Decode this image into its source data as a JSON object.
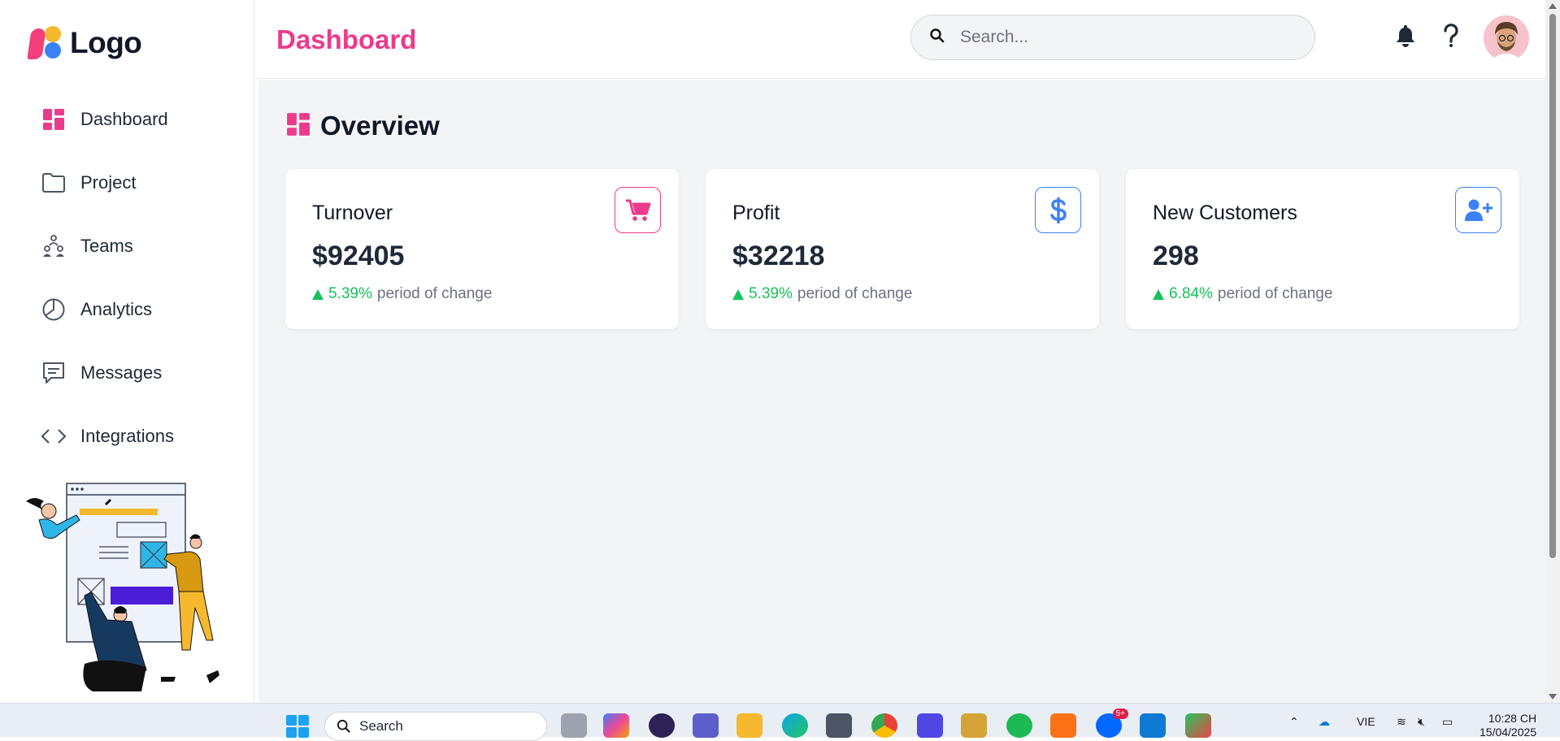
{
  "sidebar": {
    "logo_text": "Logo",
    "items": [
      {
        "label": "Dashboard",
        "icon": "dashboard-grid-icon"
      },
      {
        "label": "Project",
        "icon": "folder-icon"
      },
      {
        "label": "Teams",
        "icon": "teams-icon"
      },
      {
        "label": "Analytics",
        "icon": "pie-chart-icon"
      },
      {
        "label": "Messages",
        "icon": "message-icon"
      },
      {
        "label": "Integrations",
        "icon": "code-brackets-icon"
      }
    ]
  },
  "header": {
    "title": "Dashboard",
    "search_placeholder": "Search..."
  },
  "main": {
    "section_title": "Overview",
    "cards": [
      {
        "title": "Turnover",
        "value": "$92405",
        "change_pct": "5.39%",
        "change_text": "period of change",
        "icon": "cart-icon",
        "color": "#ec3a8c"
      },
      {
        "title": "Profit",
        "value": "$32218",
        "change_pct": "5.39%",
        "change_text": "period of change",
        "icon": "dollar-icon",
        "color": "#3b82f6"
      },
      {
        "title": "New Customers",
        "value": "298",
        "change_pct": "6.84%",
        "change_text": "period of change",
        "icon": "user-plus-icon",
        "color": "#3b82f6"
      }
    ]
  },
  "colors": {
    "accent_pink": "#ec3a8c",
    "accent_blue": "#3b82f6",
    "positive_green": "#16c15a",
    "background": "#f3f4f6"
  },
  "taskbar": {
    "search_label": "Search",
    "language": "VIE",
    "time": "10:28 CH",
    "date": "15/04/2025",
    "zalo_badge": "5+"
  }
}
